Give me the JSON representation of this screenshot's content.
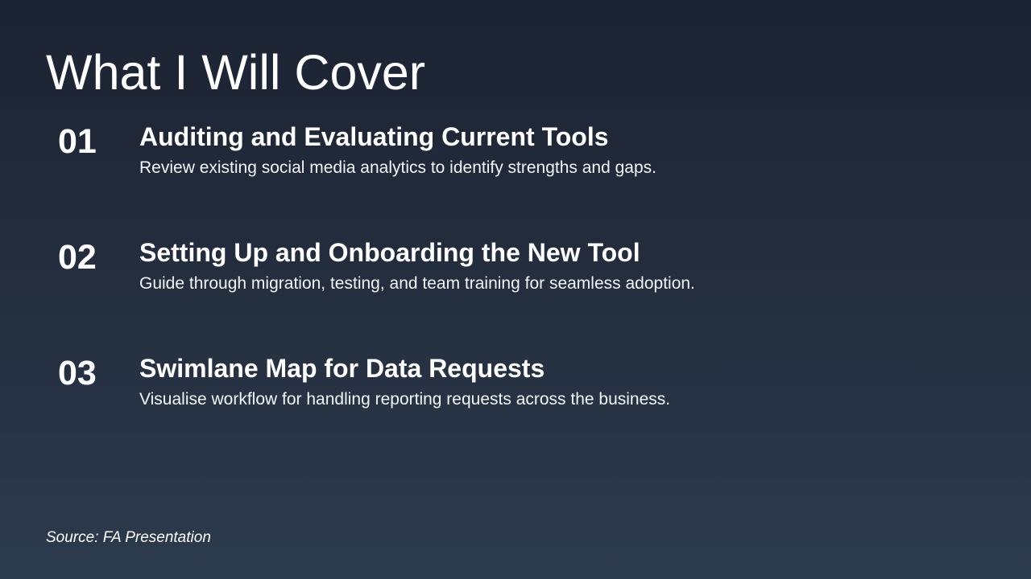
{
  "slide": {
    "title": "What I Will Cover",
    "items": [
      {
        "number": "01",
        "heading": "Auditing and Evaluating Current Tools",
        "description": "Review existing social media analytics to identify strengths and gaps."
      },
      {
        "number": "02",
        "heading": "Setting Up and Onboarding the New Tool",
        "description": "Guide through migration, testing, and team training for seamless adoption."
      },
      {
        "number": "03",
        "heading": "Swimlane Map for Data Requests",
        "description": "Visualise workflow for handling reporting requests across the business."
      }
    ],
    "source": "Source: FA Presentation"
  }
}
